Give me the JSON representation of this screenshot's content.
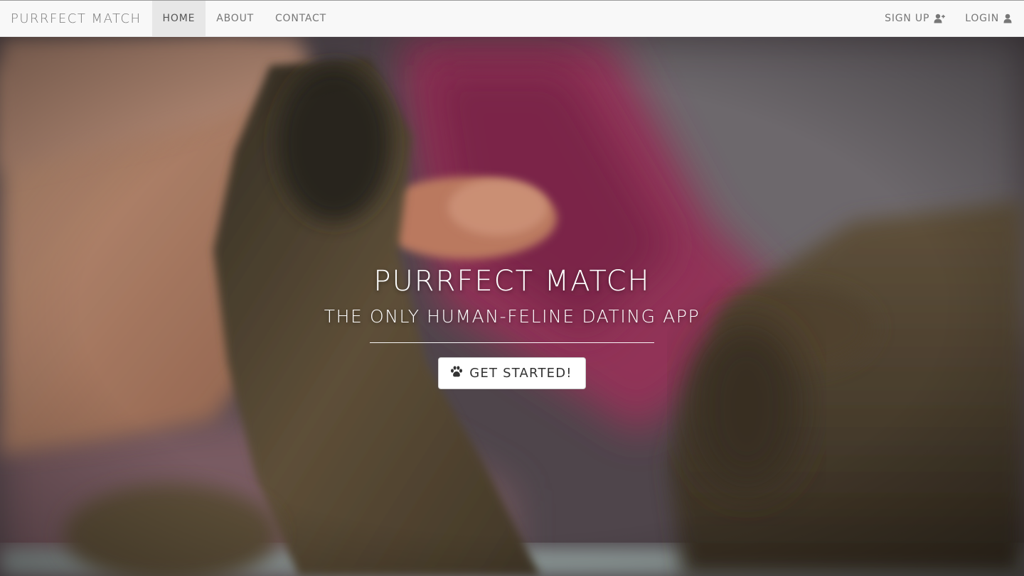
{
  "navbar": {
    "brand": "PURRFECT MATCH",
    "items": [
      {
        "label": "HOME",
        "active": true
      },
      {
        "label": "ABOUT",
        "active": false
      },
      {
        "label": "CONTACT",
        "active": false
      }
    ],
    "right_items": [
      {
        "label": "SIGN UP",
        "icon": "user-plus-icon"
      },
      {
        "label": "LOGIN",
        "icon": "user-icon"
      }
    ]
  },
  "hero": {
    "title": "PURRFECT MATCH",
    "subtitle": "THE ONLY HUMAN-FELINE DATING APP",
    "cta_label": "GET STARTED!",
    "cta_icon": "paw-icon",
    "background": "photo-hand-and-cat-paw"
  },
  "colors": {
    "navbar_bg": "#f8f8f8",
    "nav_text": "#777777",
    "nav_active_bg": "#e7e7e7",
    "hero_text": "#ffffff",
    "button_bg": "#ffffff"
  }
}
